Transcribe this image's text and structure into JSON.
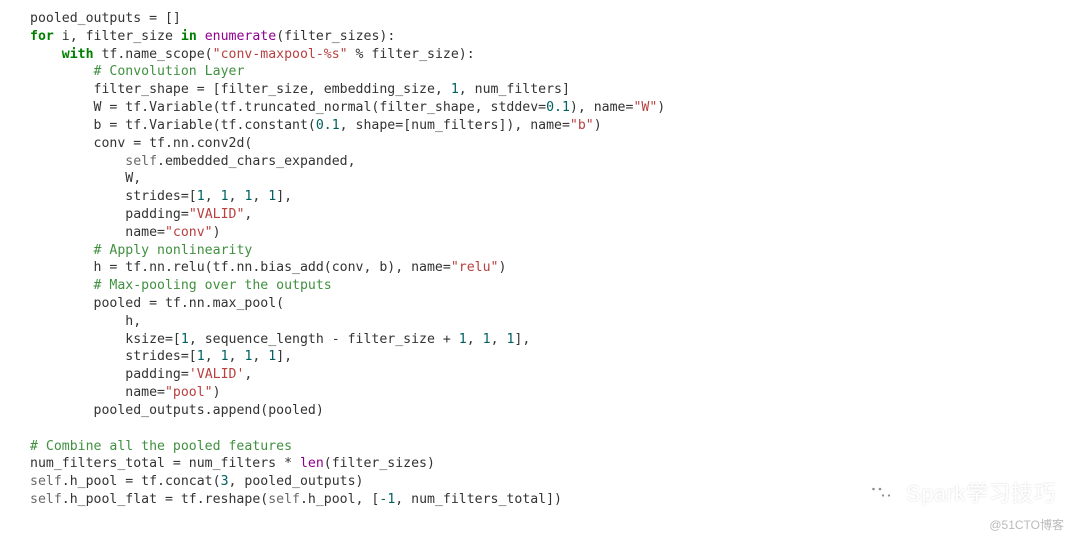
{
  "code": {
    "l01_a": "pooled_outputs = []",
    "l02_kw1": "for",
    "l02_a": " i, filter_size ",
    "l02_kw2": "in",
    "l02_sp": " ",
    "l02_bi": "enumerate",
    "l02_b": "(filter_sizes):",
    "l03_kw": "with",
    "l03_a": " tf.name_scope(",
    "l03_str": "\"conv-maxpool-%s\"",
    "l03_b": " % filter_size):",
    "l04_cmt": "# Convolution Layer",
    "l05_a": "filter_shape = [filter_size, embedding_size, ",
    "l05_n1": "1",
    "l05_b": ", num_filters]",
    "l06_a": "W = tf.Variable(tf.truncated_normal(filter_shape, stddev=",
    "l06_n": "0.1",
    "l06_b": "), name=",
    "l06_str": "\"W\"",
    "l06_c": ")",
    "l07_a": "b = tf.Variable(tf.constant(",
    "l07_n": "0.1",
    "l07_b": ", shape=[num_filters]), name=",
    "l07_str": "\"b\"",
    "l07_c": ")",
    "l08_a": "conv = tf.nn.conv2d(",
    "l09_self": "self",
    "l09_a": ".embedded_chars_expanded,",
    "l10_a": "W,",
    "l11_a": "strides=[",
    "l11_n1": "1",
    "l11_c1": ", ",
    "l11_n2": "1",
    "l11_c2": ", ",
    "l11_n3": "1",
    "l11_c3": ", ",
    "l11_n4": "1",
    "l11_b": "],",
    "l12_a": "padding=",
    "l12_str": "\"VALID\"",
    "l12_b": ",",
    "l13_a": "name=",
    "l13_str": "\"conv\"",
    "l13_b": ")",
    "l14_cmt": "# Apply nonlinearity",
    "l15_a": "h = tf.nn.relu(tf.nn.bias_add(conv, b), name=",
    "l15_str": "\"relu\"",
    "l15_b": ")",
    "l16_cmt": "# Max-pooling over the outputs",
    "l17_a": "pooled = tf.nn.max_pool(",
    "l18_a": "h,",
    "l19_a": "ksize=[",
    "l19_n1": "1",
    "l19_b": ", sequence_length - filter_size + ",
    "l19_n2": "1",
    "l19_c": ", ",
    "l19_n3": "1",
    "l19_d": ", ",
    "l19_n4": "1",
    "l19_e": "],",
    "l20_a": "strides=[",
    "l20_n1": "1",
    "l20_c1": ", ",
    "l20_n2": "1",
    "l20_c2": ", ",
    "l20_n3": "1",
    "l20_c3": ", ",
    "l20_n4": "1",
    "l20_b": "],",
    "l21_a": "padding=",
    "l21_str": "'VALID'",
    "l21_b": ",",
    "l22_a": "name=",
    "l22_str": "\"pool\"",
    "l22_b": ")",
    "l23_a": "pooled_outputs.append(pooled)",
    "l25_cmt": "# Combine all the pooled features",
    "l26_a": "num_filters_total = num_filters * ",
    "l26_bi": "len",
    "l26_b": "(filter_sizes)",
    "l27_self": "self",
    "l27_a": ".h_pool = tf.concat(",
    "l27_n": "3",
    "l27_b": ", pooled_outputs)",
    "l28_self": "self",
    "l28_a": ".h_pool_flat = tf.reshape(",
    "l28_self2": "self",
    "l28_b": ".h_pool, [",
    "l28_n": "-1",
    "l28_c": ", num_filters_total])"
  },
  "watermark": "Spark学习技巧",
  "attribution": "@51CTO博客"
}
